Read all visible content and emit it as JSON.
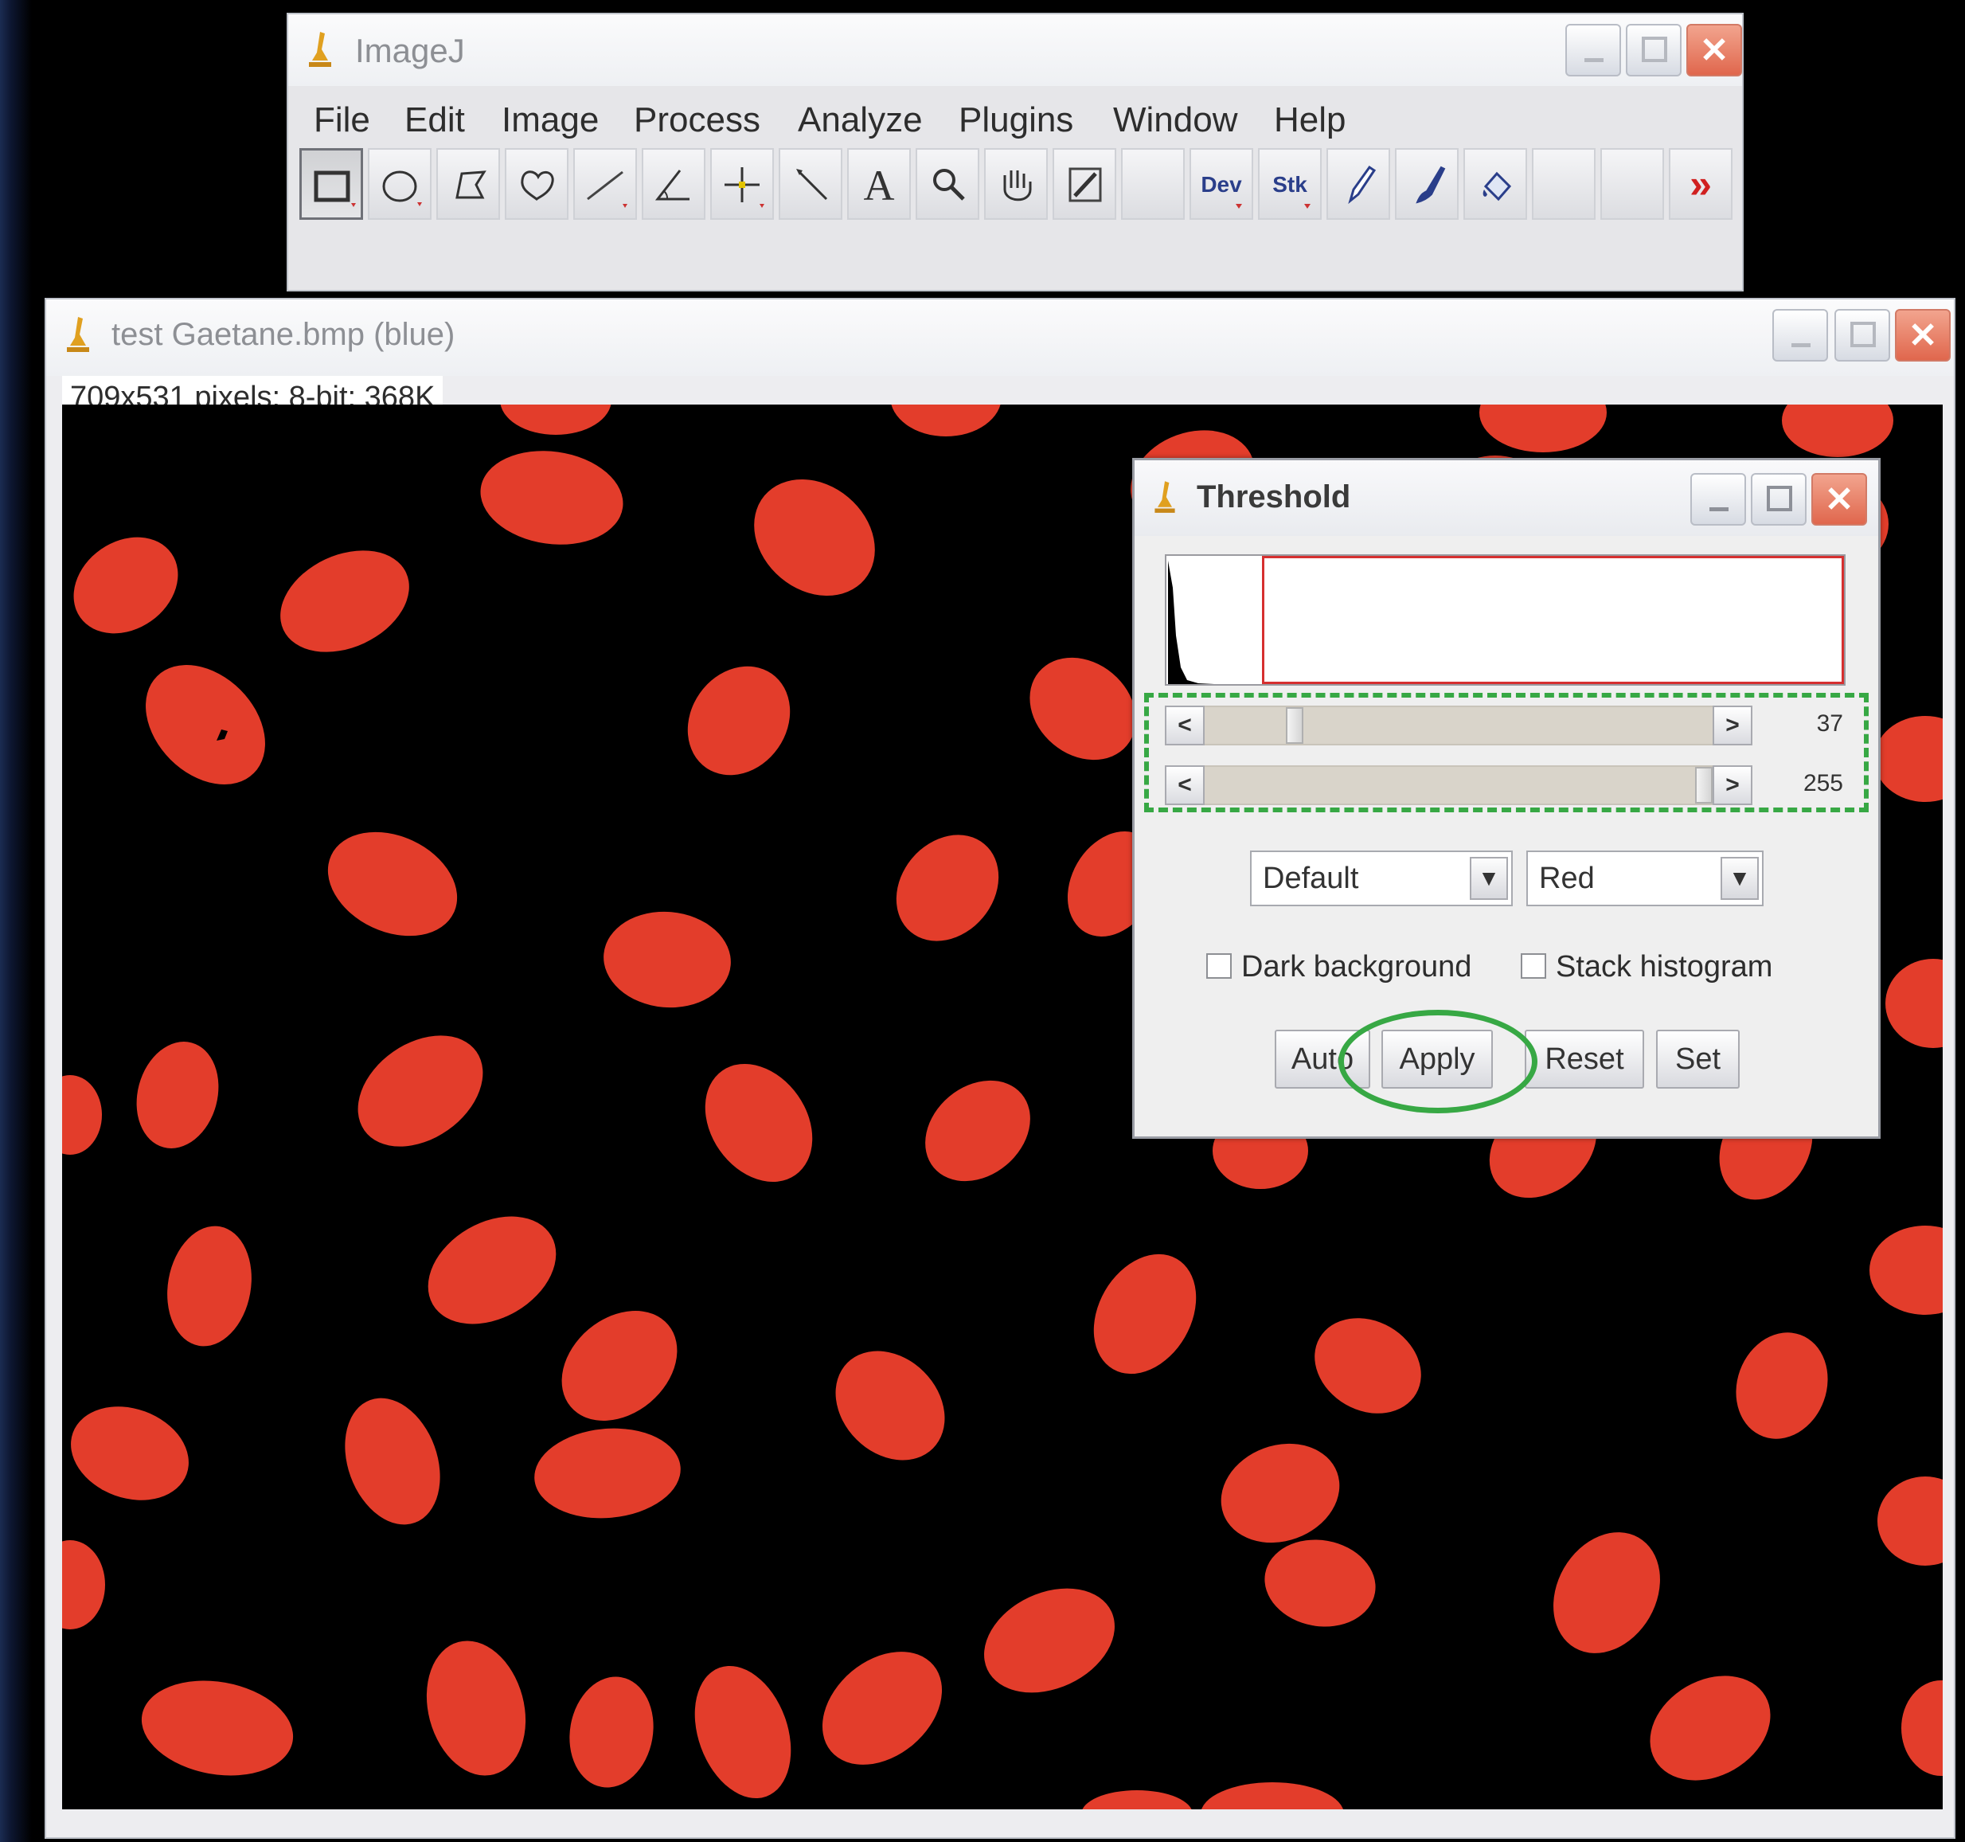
{
  "imagej_window": {
    "title": "ImageJ",
    "menu": [
      "File",
      "Edit",
      "Image",
      "Process",
      "Analyze",
      "Plugins",
      "Window",
      "Help"
    ],
    "tools": {
      "dev": "Dev",
      "stk": "Stk",
      "text_tool": "A",
      "more": "»"
    }
  },
  "image_window": {
    "title": "test Gaetane.bmp (blue)",
    "info": "709x531 pixels; 8-bit; 368K"
  },
  "threshold_dialog": {
    "title": "Threshold",
    "lower_value": "37",
    "upper_value": "255",
    "method_select": "Default",
    "display_select": "Red",
    "dark_background_label": "Dark background",
    "stack_histogram_label": "Stack histogram",
    "dark_background_checked": false,
    "stack_histogram_checked": false,
    "buttons": {
      "auto": "Auto",
      "apply": "Apply",
      "reset": "Reset",
      "set": "Set"
    }
  },
  "colors": {
    "nucleus": "#e33d2b",
    "canvas": "#000000",
    "annotation_green": "#37a844",
    "threshold_red": "#d63030"
  }
}
